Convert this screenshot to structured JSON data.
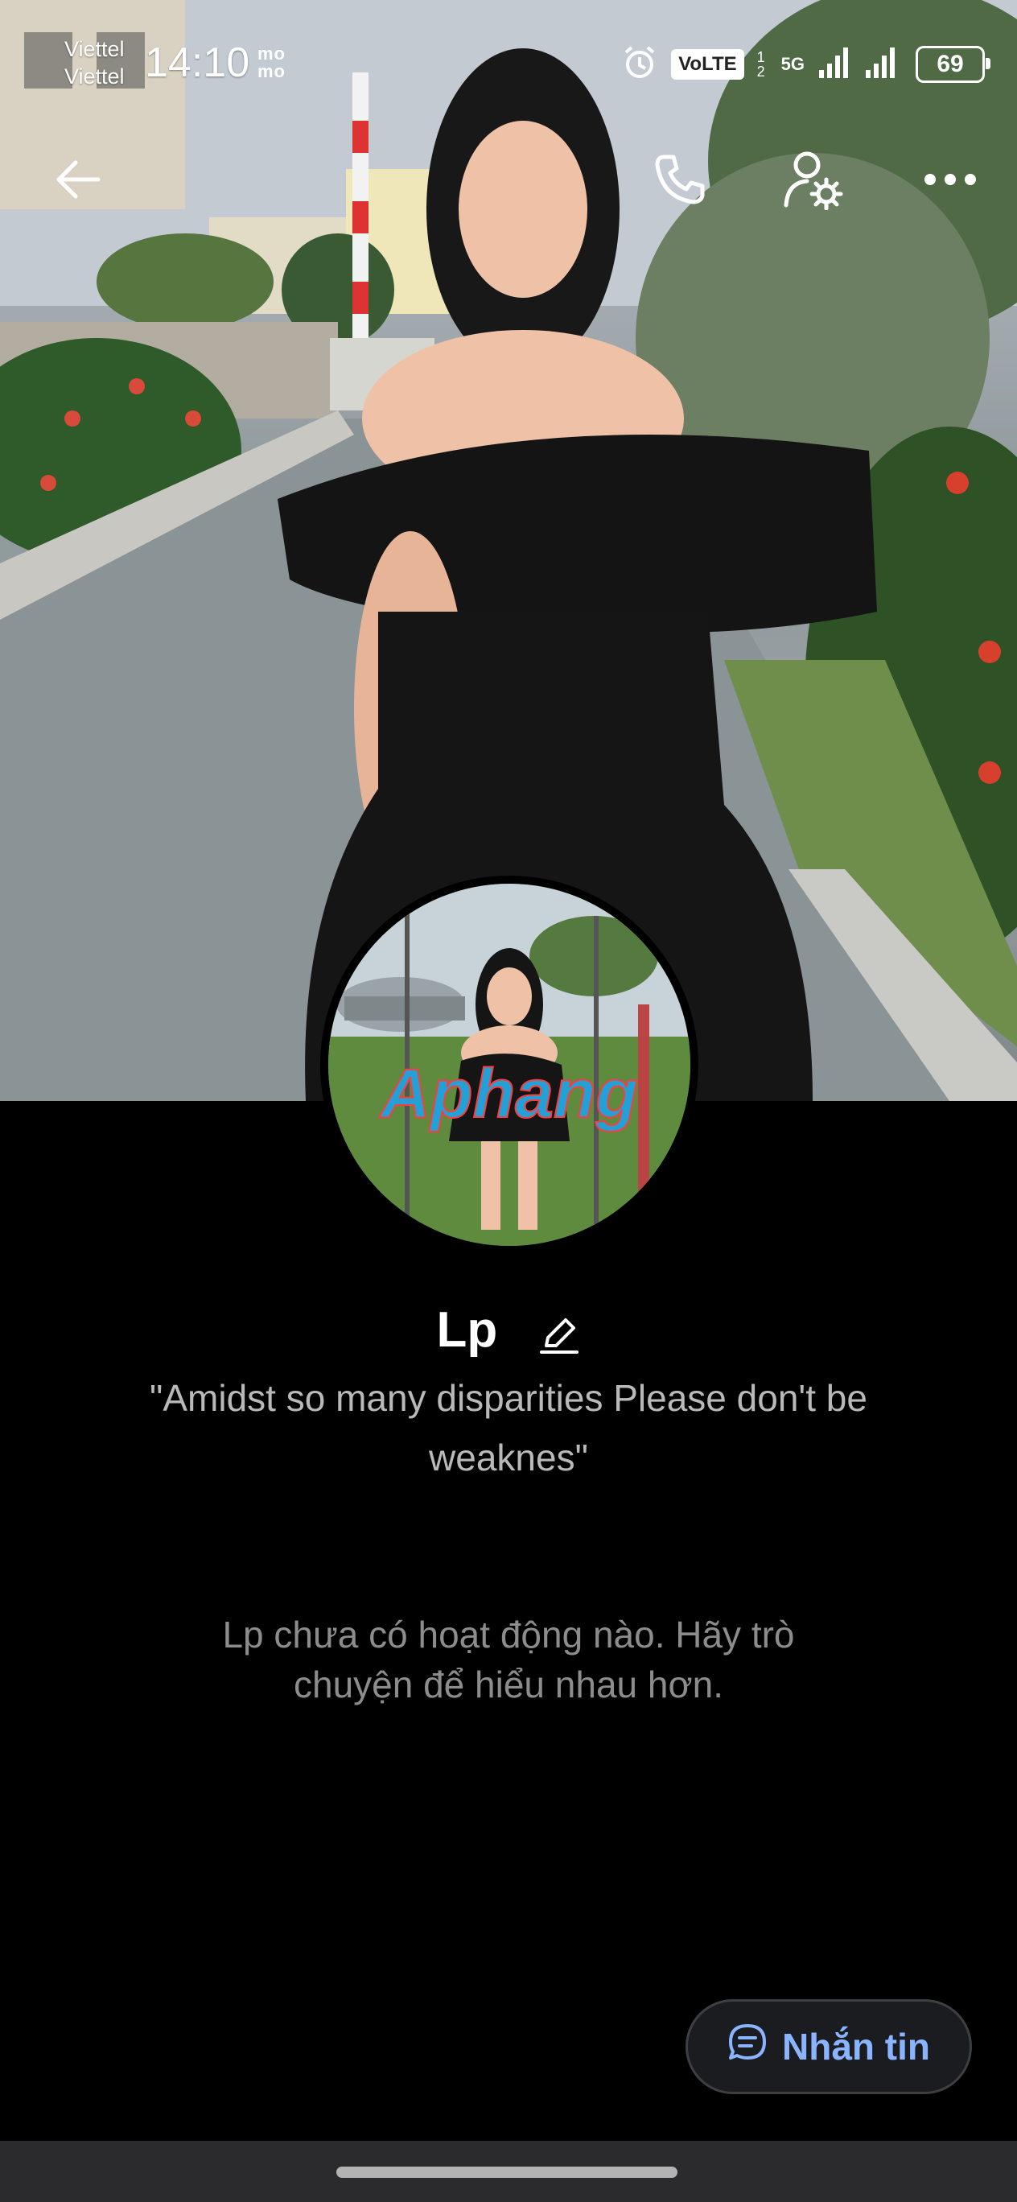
{
  "status_bar": {
    "carrier_line1": "Viettel",
    "carrier_line2": "Viettel",
    "time": "14:10",
    "momo_line1": "mo",
    "momo_line2": "mo",
    "volte": "VoLTE",
    "sim_slots": "1 2",
    "network_type": "5G",
    "battery_level": "69"
  },
  "toolbar": {
    "back_icon": "arrow-left-icon",
    "call_icon": "phone-icon",
    "settings_icon": "user-settings-icon",
    "more_icon": "more-horizontal-icon"
  },
  "avatar": {
    "watermark": "Aphang"
  },
  "profile": {
    "name": "Lp",
    "bio": "\"Amidst so many disparities Please don't be weaknes\"",
    "empty_activity": "Lp chưa có hoạt động nào. Hãy trò chuyện để hiểu nhau hơn."
  },
  "actions": {
    "message_label": "Nhắn tin",
    "message_icon": "chat-bubble-icon"
  },
  "colors": {
    "background": "#000000",
    "accent": "#8ab4ff",
    "button_bg": "#1b1c1f",
    "muted_text": "#8c8c8c"
  }
}
